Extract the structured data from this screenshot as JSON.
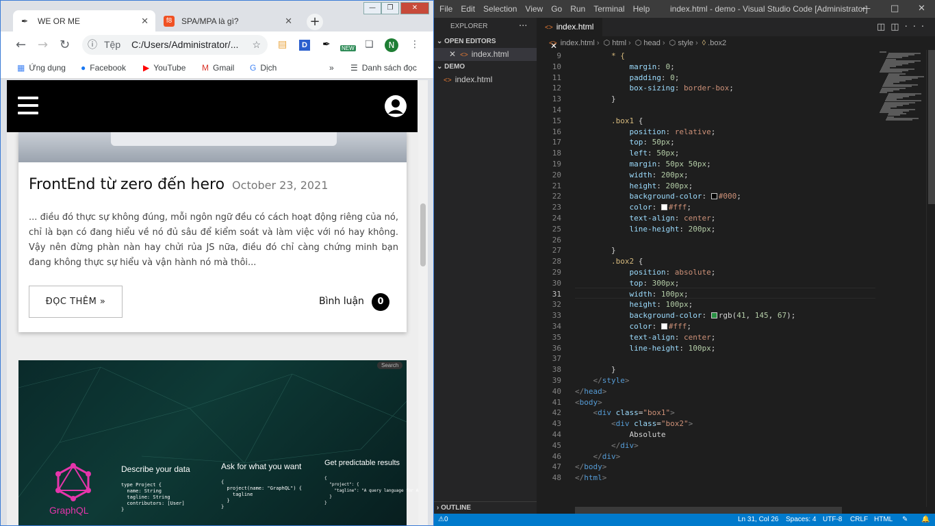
{
  "chrome": {
    "tabs": [
      {
        "title": "WE OR ME",
        "active": true
      },
      {
        "title": "SPA/MPA là gì?",
        "active": false
      }
    ],
    "omnibox": {
      "label": "Tệp",
      "url": "C:/Users/Administrator/..."
    },
    "bookmarks": [
      {
        "label": "Ứng dụng"
      },
      {
        "label": "Facebook"
      },
      {
        "label": "YouTube"
      },
      {
        "label": "Gmail"
      },
      {
        "label": "Dịch"
      },
      {
        "label": "Danh sách đọc"
      }
    ],
    "ext_new_badge": "NEW",
    "profile_initial": "N",
    "ext_d": "D",
    "overflow": "»"
  },
  "page": {
    "post_title": "FrontEnd từ zero đến hero",
    "post_date": "October 23, 2021",
    "excerpt": "... điều đó thực sự không đúng, mỗi ngôn ngữ đều có cách hoạt động riêng của nó, chỉ là bạn có đang hiểu về nó đủ sâu để kiểm soát và làm việc với nó hay không. Vậy nên đừng phàn nàn hay chửi rủa JS nữa, điều đó chỉ càng chứng minh bạn đang không thực sự hiểu và vận hành nó mà thôi...",
    "read_more": "ĐỌC THÊM »",
    "comments_label": "Bình luận",
    "comments_count": "0",
    "graphql": {
      "logo_text": "GraphQL",
      "col1": "Describe your data",
      "col2": "Ask for what you want",
      "col3": "Get predictable results",
      "search": "Search",
      "code1": [
        "type Project {",
        "  name: String",
        "  tagline: String",
        "  contributors: [User]",
        "}"
      ],
      "code2": [
        "{",
        "  project(name: \"GraphQL\") {",
        "    tagline",
        "  }",
        "}"
      ],
      "code3": [
        "{",
        "  \"project\": {",
        "    \"tagline\": \"A query language for APIs\"",
        "  }",
        "}"
      ]
    }
  },
  "vscode": {
    "menu": [
      "File",
      "Edit",
      "Selection",
      "View",
      "Go",
      "Run",
      "Terminal",
      "Help"
    ],
    "window_title": "index.html - demo - Visual Studio Code [Administrator]",
    "explorer_title": "EXPLORER",
    "open_editors": "OPEN EDITORS",
    "open_file": "index.html",
    "folder": "DEMO",
    "folder_file": "index.html",
    "outline": "OUTLINE",
    "tab": "index.html",
    "breadcrumb": [
      "index.html",
      "html",
      "head",
      "style",
      ".box2"
    ],
    "status": {
      "errors": "0",
      "position": "Ln 31, Col 26",
      "spaces": "Spaces: 4",
      "encoding": "UTF-8",
      "eol": "CRLF",
      "language": "HTML"
    },
    "lines": [
      {
        "n": "9",
        "html": "<span class='sel-c'>        * {</span>"
      },
      {
        "n": "10",
        "html": "            <span class='prop'>margin</span>: <span class='num'>0</span>;"
      },
      {
        "n": "11",
        "html": "            <span class='prop'>padding</span>: <span class='num'>0</span>;"
      },
      {
        "n": "12",
        "html": "            <span class='prop'>box-sizing</span>: <span class='val'>border-box</span>;"
      },
      {
        "n": "13",
        "html": "        }"
      },
      {
        "n": "14",
        "html": ""
      },
      {
        "n": "15",
        "html": "        <span class='sel-c'>.box1</span> {"
      },
      {
        "n": "16",
        "html": "            <span class='prop'>position</span>: <span class='val'>relative</span>;"
      },
      {
        "n": "17",
        "html": "            <span class='prop'>top</span>: <span class='num'>50px</span>;"
      },
      {
        "n": "18",
        "html": "            <span class='prop'>left</span>: <span class='num'>50px</span>;"
      },
      {
        "n": "19",
        "html": "            <span class='prop'>margin</span>: <span class='num'>50px 50px</span>;"
      },
      {
        "n": "20",
        "html": "            <span class='prop'>width</span>: <span class='num'>200px</span>;"
      },
      {
        "n": "21",
        "html": "            <span class='prop'>height</span>: <span class='num'>200px</span>;"
      },
      {
        "n": "22",
        "html": "            <span class='prop'>background-color</span>: <span class='sw' style='background:#000'></span><span class='val'>#000</span>;"
      },
      {
        "n": "23",
        "html": "            <span class='prop'>color</span>: <span class='sw' style='background:#fff'></span><span class='val'>#fff</span>;"
      },
      {
        "n": "24",
        "html": "            <span class='prop'>text-align</span>: <span class='val'>center</span>;"
      },
      {
        "n": "25",
        "html": "            <span class='prop'>line-height</span>: <span class='num'>200px</span>;"
      },
      {
        "n": "26",
        "html": ""
      },
      {
        "n": "27",
        "html": "        }"
      },
      {
        "n": "28",
        "html": "        <span class='sel-c'>.box2</span> {"
      },
      {
        "n": "29",
        "html": "            <span class='prop'>position</span>: <span class='val'>absolute</span>;"
      },
      {
        "n": "30",
        "html": "            <span class='prop'>top</span>: <span class='num'>300px</span>;"
      },
      {
        "n": "31",
        "html": "            <span class='prop'>width</span>: <span class='num'>100px</span>;"
      },
      {
        "n": "32",
        "html": "            <span class='prop'>height</span>: <span class='num'>100px</span>;"
      },
      {
        "n": "33",
        "html": "            <span class='prop'>background-color</span>: <span class='sw' style='background:#299143'></span>rgb(<span class='num'>41</span>, <span class='num'>145</span>, <span class='num'>67</span>);"
      },
      {
        "n": "34",
        "html": "            <span class='prop'>color</span>: <span class='sw' style='background:#fff'></span><span class='val'>#fff</span>;"
      },
      {
        "n": "35",
        "html": "            <span class='prop'>text-align</span>: <span class='val'>center</span>;"
      },
      {
        "n": "36",
        "html": "            <span class='prop'>line-height</span>: <span class='num'>100px</span>;"
      },
      {
        "n": "37",
        "html": ""
      },
      {
        "n": "38",
        "html": "        }"
      },
      {
        "n": "39",
        "html": "    <span class='punc'>&lt;/</span><span class='tag'>style</span><span class='punc'>&gt;</span>"
      },
      {
        "n": "40",
        "html": "<span class='punc'>&lt;/</span><span class='tag'>head</span><span class='punc'>&gt;</span>"
      },
      {
        "n": "41",
        "html": "<span class='punc'>&lt;</span><span class='tag'>body</span><span class='punc'>&gt;</span>"
      },
      {
        "n": "42",
        "html": "    <span class='punc'>&lt;</span><span class='tag'>div</span> <span class='attr'>class</span>=<span class='str'>\"box1\"</span><span class='punc'>&gt;</span>"
      },
      {
        "n": "43",
        "html": "        <span class='punc'>&lt;</span><span class='tag'>div</span> <span class='attr'>class</span>=<span class='str'>\"box2\"</span><span class='punc'>&gt;</span>"
      },
      {
        "n": "44",
        "html": "            Absolute"
      },
      {
        "n": "45",
        "html": "        <span class='punc'>&lt;/</span><span class='tag'>div</span><span class='punc'>&gt;</span>"
      },
      {
        "n": "46",
        "html": "    <span class='punc'>&lt;/</span><span class='tag'>div</span><span class='punc'>&gt;</span>"
      },
      {
        "n": "47",
        "html": "<span class='punc'>&lt;/</span><span class='tag'>body</span><span class='punc'>&gt;</span>"
      },
      {
        "n": "48",
        "html": "<span class='punc'>&lt;/</span><span class='tag'>html</span><span class='punc'>&gt;</span>"
      }
    ],
    "current_line": "31"
  }
}
